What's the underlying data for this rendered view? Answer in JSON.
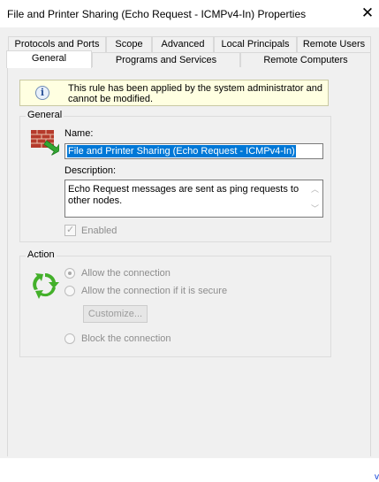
{
  "window": {
    "title": "File and Printer Sharing (Echo Request - ICMPv4-In) Properties"
  },
  "tabs_back": [
    {
      "label": "Protocols and Ports"
    },
    {
      "label": "Scope"
    },
    {
      "label": "Advanced"
    },
    {
      "label": "Local Principals"
    },
    {
      "label": "Remote Users"
    }
  ],
  "tabs_front": [
    {
      "label": "General",
      "active": true
    },
    {
      "label": "Programs and Services"
    },
    {
      "label": "Remote Computers"
    }
  ],
  "info": {
    "message": "This rule has been applied by the system administrator and cannot be modified."
  },
  "general": {
    "group_label": "General",
    "name_label": "Name:",
    "name_value": "File and Printer Sharing (Echo Request - ICMPv4-In)",
    "description_label": "Description:",
    "description_value": "Echo Request messages are sent as ping requests to other nodes.",
    "enabled_label": "Enabled",
    "enabled": true
  },
  "action": {
    "group_label": "Action",
    "options": [
      {
        "label": "Allow the connection",
        "selected": true
      },
      {
        "label": "Allow the connection if it is secure",
        "selected": false
      },
      {
        "label": "Block the connection",
        "selected": false
      }
    ],
    "customize_label": "Customize..."
  },
  "colors": {
    "accent": "#0078d7",
    "info_bg": "#ffffe1",
    "disabled_text": "#8d8d8d"
  }
}
